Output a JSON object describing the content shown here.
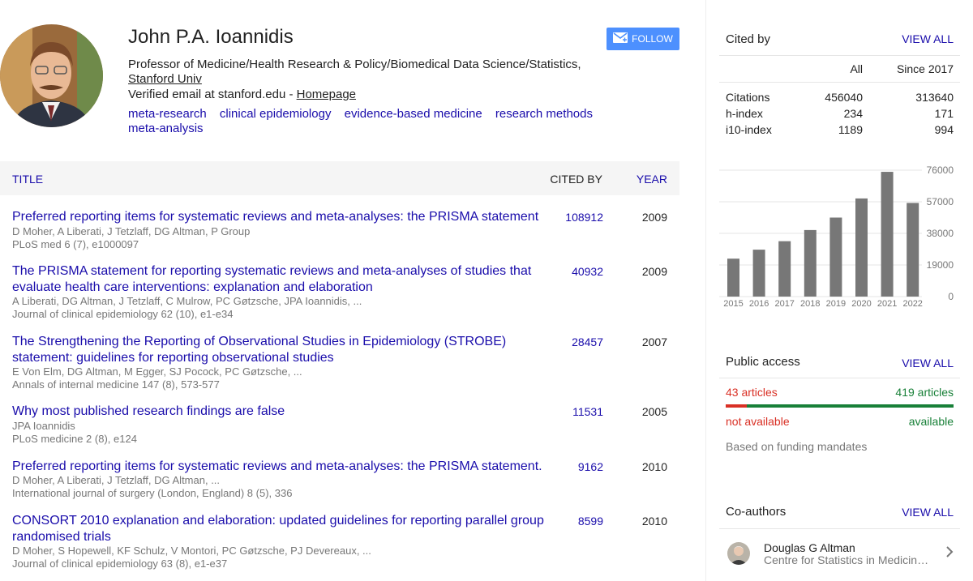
{
  "profile": {
    "name": "John P.A. Ioannidis",
    "affiliation_line": "Professor of Medicine/Health Research & Policy/Biomedical Data Science/Statistics,",
    "affiliation_org": "Stanford Univ",
    "verified_prefix": "Verified email at stanford.edu - ",
    "homepage_label": "Homepage",
    "interests": [
      "meta-research",
      "clinical epidemiology",
      "evidence-based medicine",
      "research methods",
      "meta-analysis"
    ],
    "follow_label": "FOLLOW",
    "follow_icon": "mail-icon"
  },
  "table": {
    "col_title": "TITLE",
    "col_cited": "CITED BY",
    "col_year": "YEAR",
    "articles": [
      {
        "title": "Preferred reporting items for systematic reviews and meta-analyses: the PRISMA statement",
        "authors": "D Moher, A Liberati, J Tetzlaff, DG Altman, P Group",
        "venue": "PLoS med 6 (7), e1000097",
        "cited": "108912",
        "year": "2009"
      },
      {
        "title": "The PRISMA statement for reporting systematic reviews and meta-analyses of studies that evaluate health care interventions: explanation and elaboration",
        "authors": "A Liberati, DG Altman, J Tetzlaff, C Mulrow, PC Gøtzsche, JPA Ioannidis, ...",
        "venue": "Journal of clinical epidemiology 62 (10), e1-e34",
        "cited": "40932",
        "year": "2009"
      },
      {
        "title": "The Strengthening the Reporting of Observational Studies in Epidemiology (STROBE) statement: guidelines for reporting observational studies",
        "authors": "E Von Elm, DG Altman, M Egger, SJ Pocock, PC Gøtzsche, ...",
        "venue": "Annals of internal medicine 147 (8), 573-577",
        "cited": "28457",
        "year": "2007"
      },
      {
        "title": "Why most published research findings are false",
        "authors": "JPA Ioannidis",
        "venue": "PLoS medicine 2 (8), e124",
        "cited": "11531",
        "year": "2005"
      },
      {
        "title": "Preferred reporting items for systematic reviews and meta-analyses: the PRISMA statement.",
        "authors": "D Moher, A Liberati, J Tetzlaff, DG Altman, ...",
        "venue": "International journal of surgery (London, England) 8 (5), 336",
        "cited": "9162",
        "year": "2010"
      },
      {
        "title": "CONSORT 2010 explanation and elaboration: updated guidelines for reporting parallel group randomised trials",
        "authors": "D Moher, S Hopewell, KF Schulz, V Montori, PC Gøtzsche, PJ Devereaux, ...",
        "venue": "Journal of clinical epidemiology 63 (8), e1-e37",
        "cited": "8599",
        "year": "2010"
      }
    ]
  },
  "cited_by": {
    "title": "Cited by",
    "view_all": "VIEW ALL",
    "col_all": "All",
    "col_since": "Since 2017",
    "rows": [
      {
        "label": "Citations",
        "all": "456040",
        "since": "313640"
      },
      {
        "label": "h-index",
        "all": "234",
        "since": "171"
      },
      {
        "label": "i10-index",
        "all": "1189",
        "since": "994"
      }
    ]
  },
  "chart_data": {
    "type": "bar",
    "categories": [
      "2015",
      "2016",
      "2017",
      "2018",
      "2019",
      "2020",
      "2021",
      "2022"
    ],
    "values": [
      22800,
      28200,
      33300,
      40000,
      47500,
      59000,
      75000,
      56300
    ],
    "ylim": [
      0,
      76000
    ],
    "yticks": [
      "76000",
      "57000",
      "38000",
      "19000",
      "0"
    ],
    "bar_color": "#777777",
    "grid": true
  },
  "public_access": {
    "title": "Public access",
    "view_all": "VIEW ALL",
    "not_available_count": "43 articles",
    "available_count": "419 articles",
    "not_available_label": "not available",
    "available_label": "available",
    "available_fraction": 0.907,
    "note": "Based on funding mandates"
  },
  "coauthors": {
    "title": "Co-authors",
    "view_all": "VIEW ALL",
    "items": [
      {
        "name": "Douglas G Altman",
        "affiliation": "Centre for Statistics in Medicine, University of Oxford"
      }
    ]
  },
  "colors": {
    "link": "#1a0dab",
    "follow": "#4d90fe",
    "red": "#d93025",
    "green": "#188038"
  }
}
